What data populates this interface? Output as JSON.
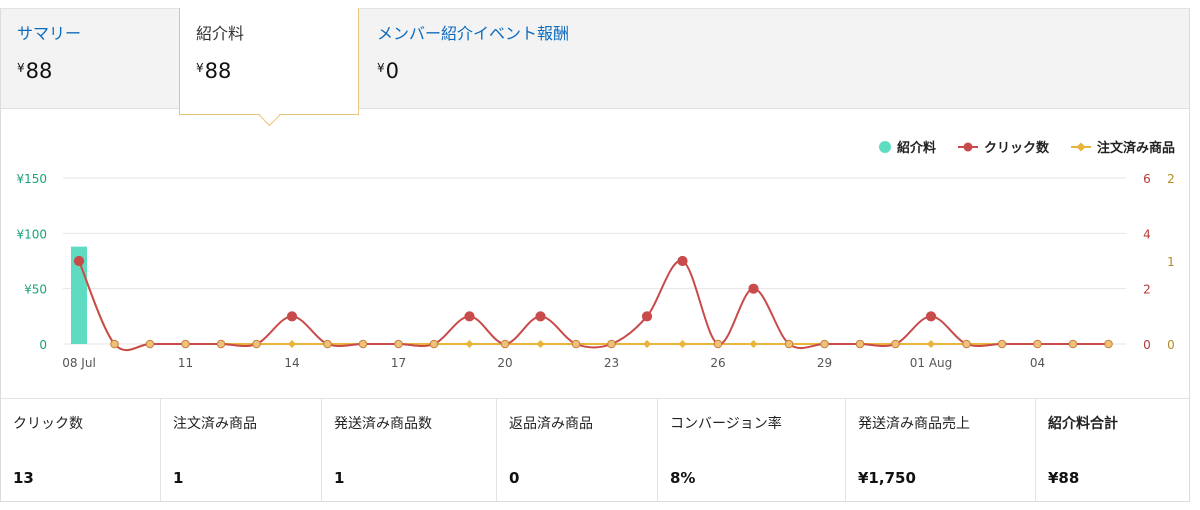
{
  "tabs": [
    {
      "label": "サマリー",
      "yen": "¥",
      "value": "88",
      "active": false
    },
    {
      "label": "紹介料",
      "yen": "¥",
      "value": "88",
      "active": true
    },
    {
      "label": "メンバー紹介イベント報酬",
      "yen": "¥",
      "value": "0",
      "active": false
    }
  ],
  "legend": {
    "fee": "紹介料",
    "clicks": "クリック数",
    "ordered": "注文済み商品"
  },
  "colors": {
    "fee": "#5edcc1",
    "clicks": "#c94a4a",
    "ordered": "#e8b53a",
    "fee_axis": "#1aa37a",
    "clicks_axis": "#b63a3a",
    "ordered_axis": "#b38a1f",
    "link": "#0f6cbd",
    "grid": "#e4e4e4"
  },
  "chart_data": {
    "type": "bar",
    "x_ticks": [
      "08 Jul",
      "11",
      "14",
      "17",
      "20",
      "23",
      "26",
      "29",
      "01 Aug",
      "04"
    ],
    "x_tick_index": [
      0,
      3,
      6,
      9,
      12,
      15,
      18,
      21,
      24,
      27
    ],
    "days": 30,
    "y_left": {
      "ticks": [
        "¥150",
        "¥100",
        "¥50",
        "0"
      ],
      "range": [
        0,
        150
      ]
    },
    "y_right_1": {
      "ticks": [
        "6",
        "4",
        "2",
        "0"
      ],
      "range": [
        0,
        6
      ]
    },
    "y_right_2": {
      "ticks": [
        "2",
        "1",
        "0"
      ],
      "range": [
        0,
        2
      ]
    },
    "series": [
      {
        "name": "紹介料",
        "type": "bar",
        "axis": "left",
        "values": [
          88,
          0,
          0,
          0,
          0,
          0,
          0,
          0,
          0,
          0,
          0,
          0,
          0,
          0,
          0,
          0,
          0,
          0,
          0,
          0,
          0,
          0,
          0,
          0,
          0,
          0,
          0,
          0,
          0,
          0
        ]
      },
      {
        "name": "クリック数",
        "type": "line",
        "axis": "right1",
        "values": [
          3,
          0,
          0,
          0,
          0,
          0,
          1,
          0,
          0,
          0,
          0,
          1,
          0,
          1,
          0,
          0,
          1,
          3,
          0,
          2,
          0,
          0,
          0,
          0,
          1,
          0,
          0,
          0,
          0,
          0
        ]
      },
      {
        "name": "注文済み商品",
        "type": "line",
        "axis": "right2",
        "values": [
          1,
          0,
          0,
          0,
          0,
          0,
          0,
          0,
          0,
          0,
          0,
          0,
          0,
          0,
          0,
          0,
          0,
          0,
          0,
          0,
          0,
          0,
          0,
          0,
          0,
          0,
          0,
          0,
          0,
          0
        ]
      }
    ]
  },
  "stats": [
    {
      "label": "クリック数",
      "value": "13"
    },
    {
      "label": "注文済み商品",
      "value": "1"
    },
    {
      "label": "発送済み商品数",
      "value": "1"
    },
    {
      "label": "返品済み商品",
      "value": "0"
    },
    {
      "label": "コンバージョン率",
      "value": "8%"
    },
    {
      "label": "発送済み商品売上",
      "value": "¥1,750"
    },
    {
      "label": "紹介料合計",
      "value": "¥88"
    }
  ]
}
